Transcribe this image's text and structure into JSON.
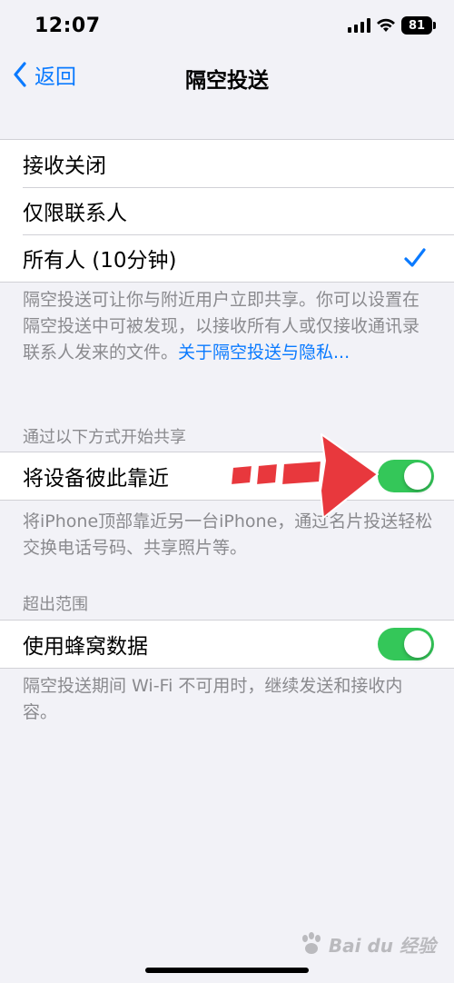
{
  "status_bar": {
    "time": "12:07",
    "battery": "81"
  },
  "nav": {
    "back_label": "返回",
    "title": "隔空投送"
  },
  "receiving": {
    "options": [
      {
        "label": "接收关闭",
        "selected": false
      },
      {
        "label": "仅限联系人",
        "selected": false
      },
      {
        "label": "所有人 (10分钟)",
        "selected": true
      }
    ],
    "footer_text": "隔空投送可让你与附近用户立即共享。你可以设置在隔空投送中可被发现，以接收所有人或仅接收通讯录联系人发来的文件。",
    "footer_link": "关于隔空投送与隐私..."
  },
  "start_sharing": {
    "header": "通过以下方式开始共享",
    "toggle_label": "将设备彼此靠近",
    "toggle_on": true,
    "footer_text": "将iPhone顶部靠近另一台iPhone，通过名片投送轻松交换电话号码、共享照片等。"
  },
  "out_of_range": {
    "header": "超出范围",
    "toggle_label": "使用蜂窝数据",
    "toggle_on": true,
    "footer_text": "隔空投送期间 Wi-Fi 不可用时，继续发送和接收内容。"
  },
  "watermark": {
    "text": "Bai du 经验"
  },
  "colors": {
    "accent": "#0a7aff",
    "toggle_on": "#34c759",
    "background": "#f2f2f7",
    "annotation_arrow": "#e8383d"
  }
}
